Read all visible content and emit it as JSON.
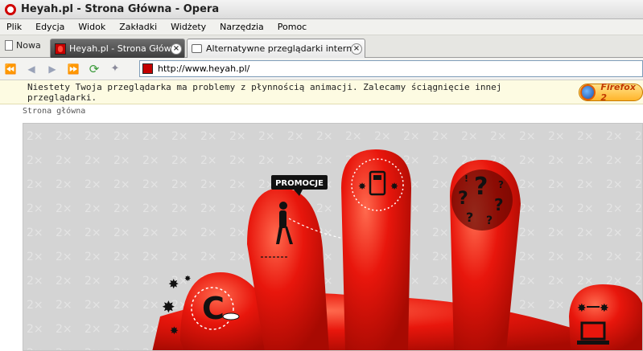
{
  "window": {
    "title": "Heyah.pl - Strona Główna - Opera"
  },
  "menu": {
    "items": [
      "Plik",
      "Edycja",
      "Widok",
      "Zakładki",
      "Widżety",
      "Narzędzia",
      "Pomoc"
    ]
  },
  "tabs": {
    "new_label": "Nowa",
    "items": [
      {
        "label": "Heyah.pl - Strona Główna",
        "active": true
      },
      {
        "label": "Alternatywne przeglądarki internet...",
        "active": false
      }
    ],
    "close_glyph": "×"
  },
  "navigation": {
    "url": "http://www.heyah.pl/",
    "icons": [
      "rewind-icon",
      "back-icon",
      "forward-icon",
      "fast-forward-icon",
      "reload-icon",
      "wand-icon"
    ]
  },
  "notice": {
    "text": "Niestety Twoja przeglądarka ma problemy z płynnością animacji. Zalecamy ściągnięcie innej przeglądarki.",
    "badge_label": "Firefox 2"
  },
  "page": {
    "breadcrumb": "Strona główna",
    "promo_label": "PROMOCJE"
  },
  "colors": {
    "hand_red": "#e8160c",
    "hand_dark": "#a70a02",
    "background_grey": "#d6d6d6"
  }
}
